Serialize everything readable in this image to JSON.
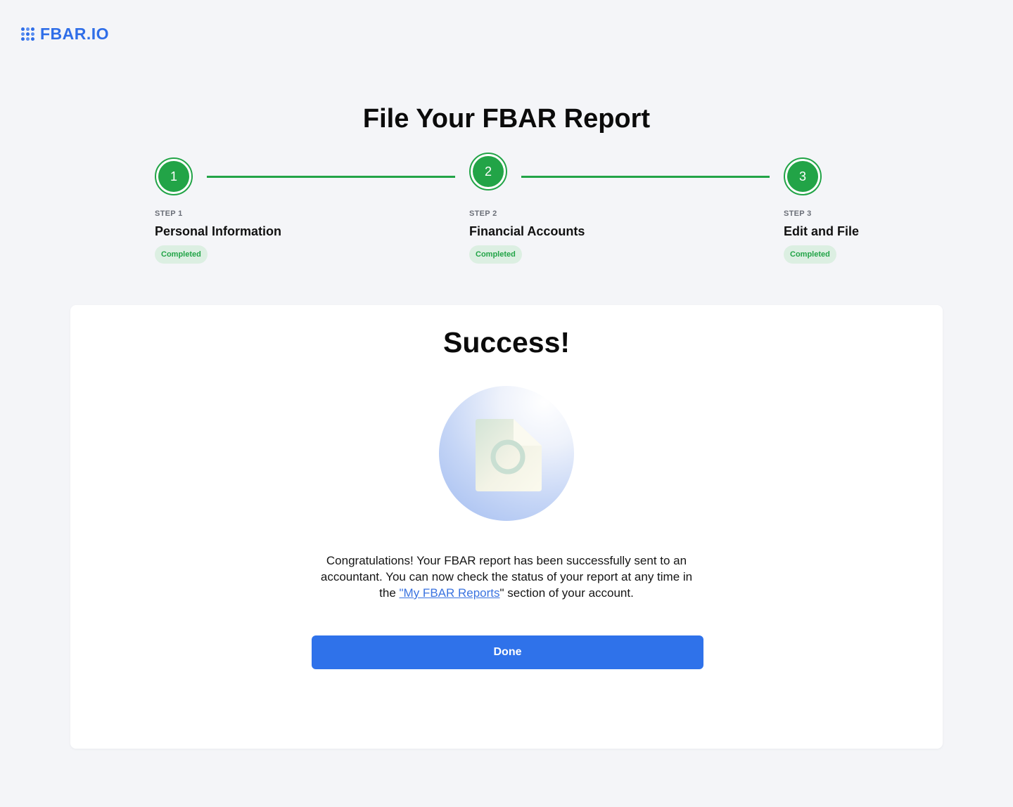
{
  "brand": {
    "logo_text": "FBAR.IO",
    "accent_color": "#2f6ee8"
  },
  "header": {
    "title": "File Your FBAR Report"
  },
  "stepper": {
    "steps": [
      {
        "number": "1",
        "label": "STEP 1",
        "name": "Personal Information",
        "status": "Completed"
      },
      {
        "number": "2",
        "label": "STEP 2",
        "name": "Financial Accounts",
        "status": "Completed"
      },
      {
        "number": "3",
        "label": "STEP 3",
        "name": "Edit and File",
        "status": "Completed"
      }
    ],
    "completed_color": "#22a447"
  },
  "success": {
    "title": "Success!",
    "illustration_icon": "document-icon",
    "message_part1": "Congratulations! Your FBAR report has been successfully sent to an accountant. You can now check the status of your report at any time in the ",
    "link_text": "\"My FBAR Reports",
    "message_part2": "\" section of your account.",
    "done_label": "Done",
    "button_color": "#2f72ea"
  }
}
